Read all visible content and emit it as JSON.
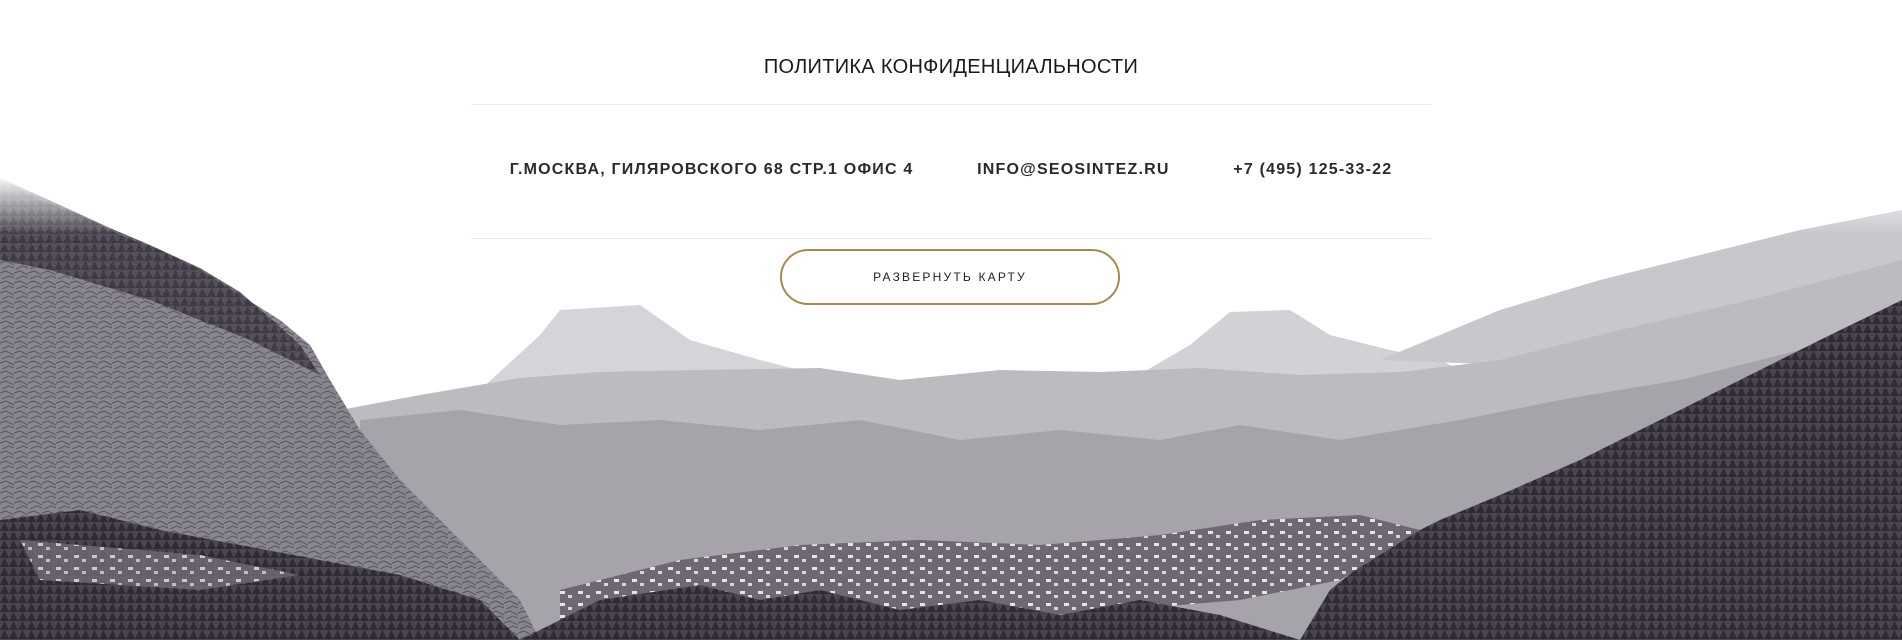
{
  "footer": {
    "privacy_policy_label": "ПОЛИТИКА КОНФИДЕНЦИАЛЬНОСТИ",
    "address": "Г.МОСКВА, ГИЛЯРОВСКОГО 68 СТР.1 ОФИС 4",
    "email": "INFO@SEOSINTEZ.RU",
    "phone": "+7 (495) 125-33-22",
    "map_button_label": "РАЗВЕРНУТЬ КАРТУ",
    "accent_color": "#a48b4d",
    "background_image": "grayscale mountain valley landscape"
  }
}
